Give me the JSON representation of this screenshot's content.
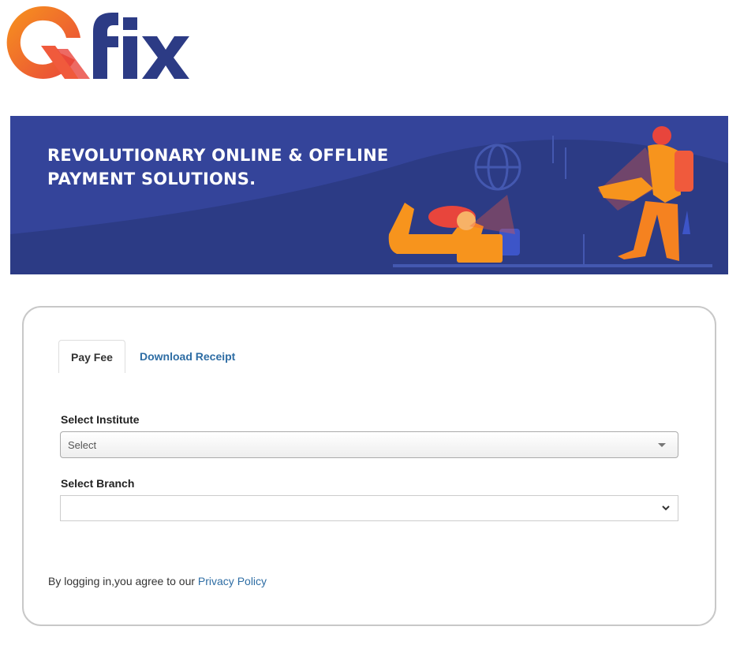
{
  "logo": {
    "text": "Qfix",
    "brand_orange": "#f58220",
    "brand_red": "#e8453c",
    "brand_navy": "#2c3b85"
  },
  "banner": {
    "line1": "REVOLUTIONARY ONLINE & OFFLINE",
    "line2": "PAYMENT SOLUTIONS.",
    "background": "#2c3b85"
  },
  "tabs": [
    {
      "label": "Pay Fee",
      "active": true
    },
    {
      "label": "Download Receipt",
      "active": false
    }
  ],
  "form": {
    "institute_label": "Select Institute",
    "institute_value": "Select",
    "branch_label": "Select Branch",
    "branch_value": ""
  },
  "footer": {
    "text": "By logging in,you agree to our ",
    "link": "Privacy Policy",
    "link_color": "#2e6da4"
  }
}
